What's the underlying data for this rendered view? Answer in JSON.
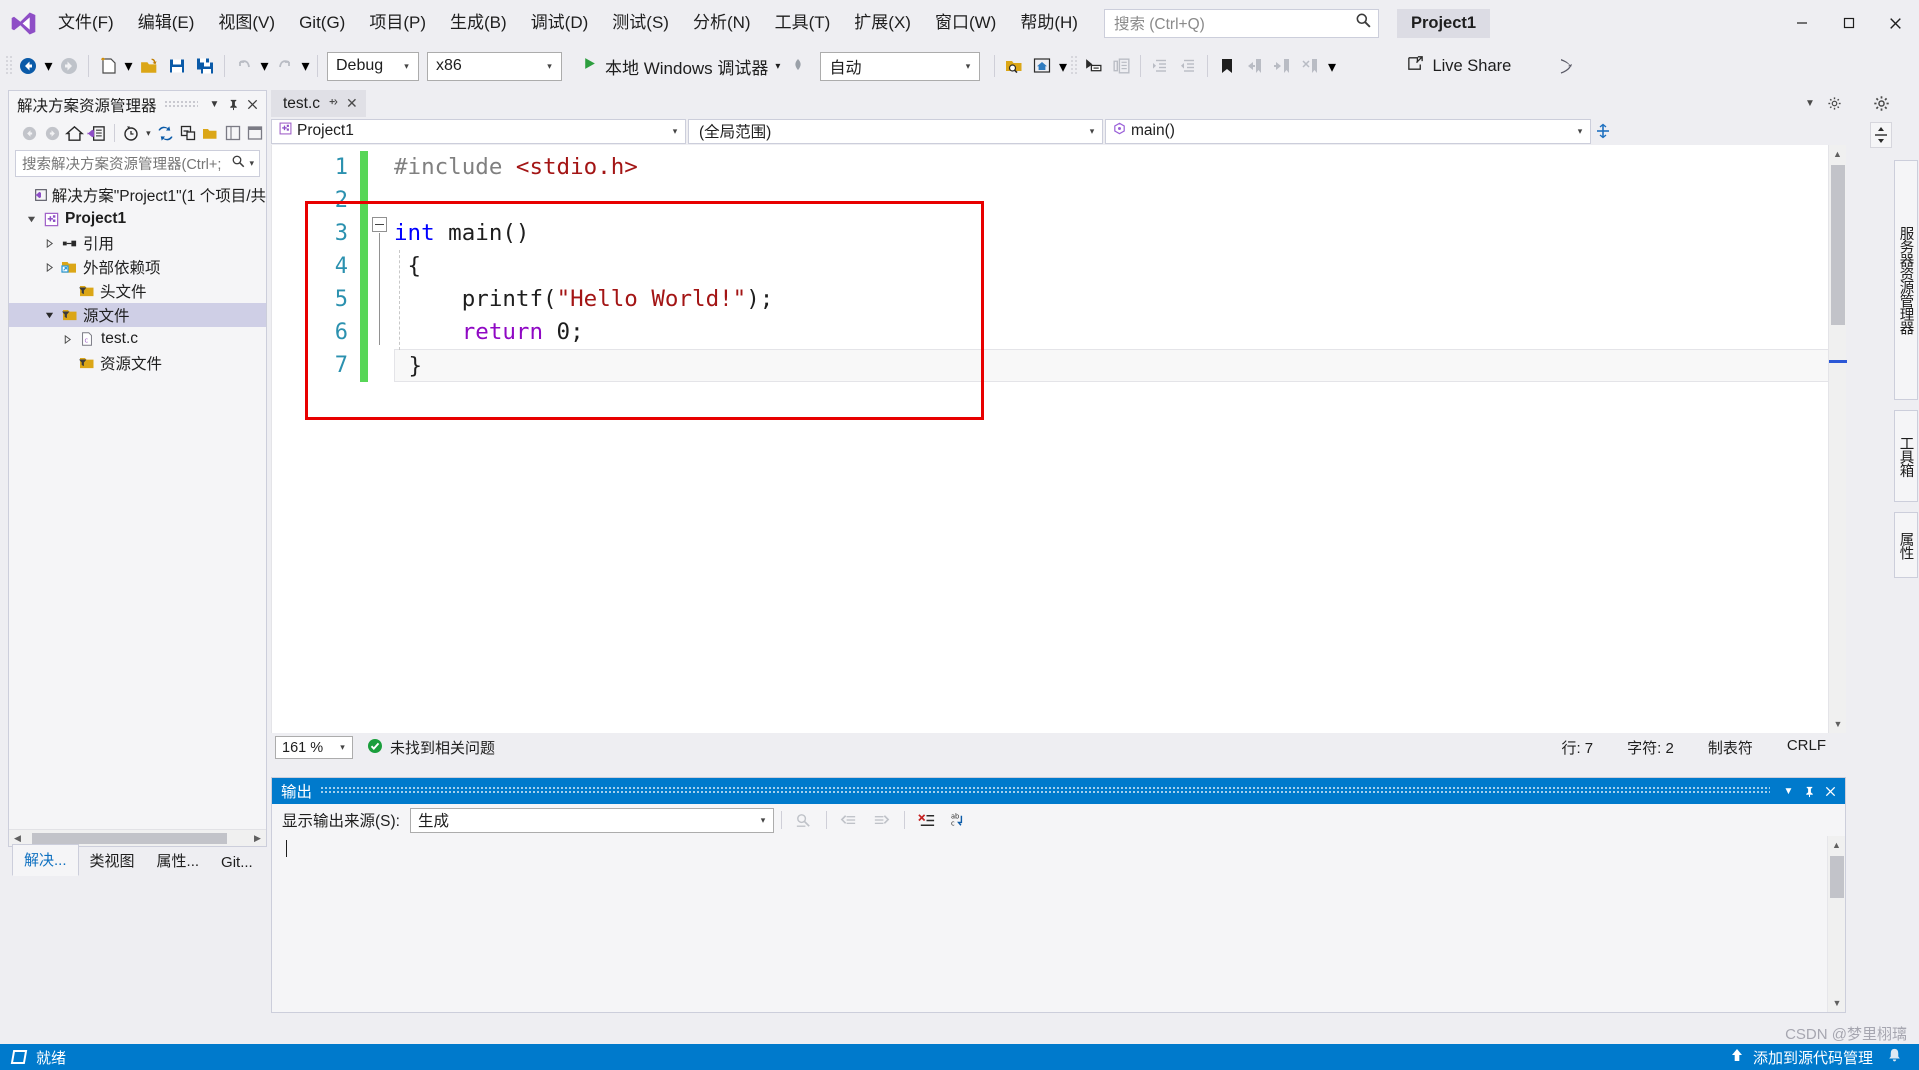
{
  "window": {
    "title": "Project1",
    "app_logo": "visual-studio-logo",
    "minimize": "—",
    "maximize": "□",
    "close": "✕"
  },
  "menu": {
    "items": [
      "文件(F)",
      "编辑(E)",
      "视图(V)",
      "Git(G)",
      "项目(P)",
      "生成(B)",
      "调试(D)",
      "测试(S)",
      "分析(N)",
      "工具(T)",
      "扩展(X)",
      "窗口(W)",
      "帮助(H)"
    ]
  },
  "search": {
    "placeholder": "搜索 (Ctrl+Q)",
    "icon": "search-icon"
  },
  "toolbar": {
    "nav_back": "back-arrow-icon",
    "nav_forward": "forward-arrow-icon",
    "new_item": "new-item-icon",
    "open_file": "open-file-icon",
    "save": "save-icon",
    "save_all": "save-all-icon",
    "undo": "undo-icon",
    "redo": "redo-icon",
    "configuration": "Debug",
    "platform": "x86",
    "run_label": "本地 Windows 调试器",
    "run_icon": "play-icon",
    "hot_reload_icon": "hot-reload-icon",
    "profile_value": "自动",
    "find_in_files": "find-in-files-icon",
    "home_icon": "home-icon",
    "comment_icon": "comment-icon",
    "uncomment_icon": "uncomment-icon",
    "indent_icon": "indent-icon",
    "outdent_icon": "outdent-icon",
    "bookmark_icon": "bookmark-icon",
    "prev_bookmark_icon": "previous-bookmark-icon",
    "next_bookmark_icon": "next-bookmark-icon",
    "clear_bookmark_icon": "clear-bookmark-icon",
    "live_share": "Live Share",
    "live_share_icon": "live-share-icon",
    "feedback_icon": "feedback-icon"
  },
  "solution_explorer": {
    "title": "解决方案资源管理器",
    "header_icons": [
      "chevron-down-icon",
      "pin-icon",
      "close-icon"
    ],
    "toolbar_icons": [
      "back-icon",
      "forward-icon",
      "home-icon",
      "vs-solution-icon",
      "pending-changes-icon",
      "refresh-icon",
      "collapse-all-icon",
      "show-all-files-icon",
      "properties-icon",
      "preview-icon"
    ],
    "search_placeholder": "搜索解决方案资源管理器(Ctrl+;",
    "tree": [
      {
        "label": "解决方案\"Project1\"(1 个项目/共",
        "icon": "solution-icon",
        "indent": 1,
        "twisty": "",
        "bold": false,
        "selected": false
      },
      {
        "label": "Project1",
        "icon": "cpp-project-icon",
        "indent": 2,
        "twisty": "▼",
        "bold": true,
        "selected": false
      },
      {
        "label": "引用",
        "icon": "references-icon",
        "indent": 3,
        "twisty": "▶",
        "bold": false,
        "selected": false
      },
      {
        "label": "外部依赖项",
        "icon": "external-dependencies-icon",
        "indent": 3,
        "twisty": "▶",
        "bold": false,
        "selected": false
      },
      {
        "label": "头文件",
        "icon": "filter-folder-icon",
        "indent": 3,
        "twisty": "",
        "bold": false,
        "selected": false
      },
      {
        "label": "源文件",
        "icon": "filter-folder-icon",
        "indent": 3,
        "twisty": "▼",
        "bold": false,
        "selected": true
      },
      {
        "label": "test.c",
        "icon": "c-file-icon",
        "indent": 4,
        "twisty": "▶",
        "bold": false,
        "selected": false
      },
      {
        "label": "资源文件",
        "icon": "filter-folder-icon",
        "indent": 3,
        "twisty": "",
        "bold": false,
        "selected": false
      }
    ],
    "tabs": [
      {
        "label": "解决...",
        "active": true
      },
      {
        "label": "类视图",
        "active": false
      },
      {
        "label": "属性...",
        "active": false
      },
      {
        "label": "Git...",
        "active": false
      }
    ]
  },
  "editor": {
    "tab": {
      "label": "test.c",
      "pin_icon": "pin-icon",
      "close_icon": "close-icon"
    },
    "tabstrip_icons": [
      "chevron-down-icon",
      "settings-icon"
    ],
    "nav": {
      "project": "Project1",
      "project_icon": "cpp-project-icon",
      "scope": "(全局范围)",
      "member": "main()",
      "member_icon": "method-icon",
      "split_icon": "split-view-icon"
    },
    "line_numbers": [
      "1",
      "2",
      "3",
      "4",
      "5",
      "6",
      "7"
    ],
    "code": [
      {
        "n": "1",
        "tokens": [
          {
            "t": "    ",
            "c": ""
          },
          {
            "t": "#include ",
            "c": "pp"
          },
          {
            "t": "<stdio.h>",
            "c": "inc"
          }
        ]
      },
      {
        "n": "2",
        "tokens": []
      },
      {
        "n": "3",
        "tokens": [
          {
            "t": "int",
            "c": "kw"
          },
          {
            "t": " main()",
            "c": ""
          }
        ]
      },
      {
        "n": "4",
        "tokens": [
          {
            "t": " {",
            "c": ""
          }
        ]
      },
      {
        "n": "5",
        "tokens": [
          {
            "t": "     printf(",
            "c": ""
          },
          {
            "t": "\"Hello World!\"",
            "c": "str"
          },
          {
            "t": ");",
            "c": ""
          }
        ]
      },
      {
        "n": "6",
        "tokens": [
          {
            "t": "     ",
            "c": ""
          },
          {
            "t": "return",
            "c": "kw2"
          },
          {
            "t": " 0;",
            "c": ""
          }
        ]
      },
      {
        "n": "7",
        "tokens": [
          {
            "t": " }",
            "c": ""
          }
        ]
      }
    ],
    "status": {
      "zoom": "161 %",
      "issue_text": "未找到相关问题",
      "issue_icon": "ok-check-icon",
      "line": "行: 7",
      "col": "字符: 2",
      "tabs_mode": "制表符",
      "eol": "CRLF"
    },
    "annotation_color": "#e80000"
  },
  "output": {
    "title": "输出",
    "header_icons": [
      "chevron-down-icon",
      "pin-icon",
      "close-icon"
    ],
    "source_label": "显示输出来源(S):",
    "source_value": "生成",
    "toolbar_icons": [
      "find-message-icon",
      "go-to-previous-icon",
      "go-to-next-icon",
      "clear-all-icon",
      "toggle-word-wrap-icon"
    ],
    "body_text": ""
  },
  "right_tabs": [
    "服务器资源管理器",
    "工具箱",
    "属性"
  ],
  "statusbar": {
    "ready": "就绪",
    "ready_icon": "stop-box-icon",
    "source_control": "添加到源代码管理",
    "source_control_icon": "up-arrow-icon",
    "notify_icon": "bell-icon"
  },
  "watermark": "CSDN @梦里栩璃",
  "colors": {
    "accent": "#007acc",
    "chrome": "#eeeef2",
    "panel": "#f5f5f7",
    "border": "#cccedb",
    "annotation_red": "#e80000",
    "change_green": "#57d657",
    "line_number": "#2b91af"
  }
}
